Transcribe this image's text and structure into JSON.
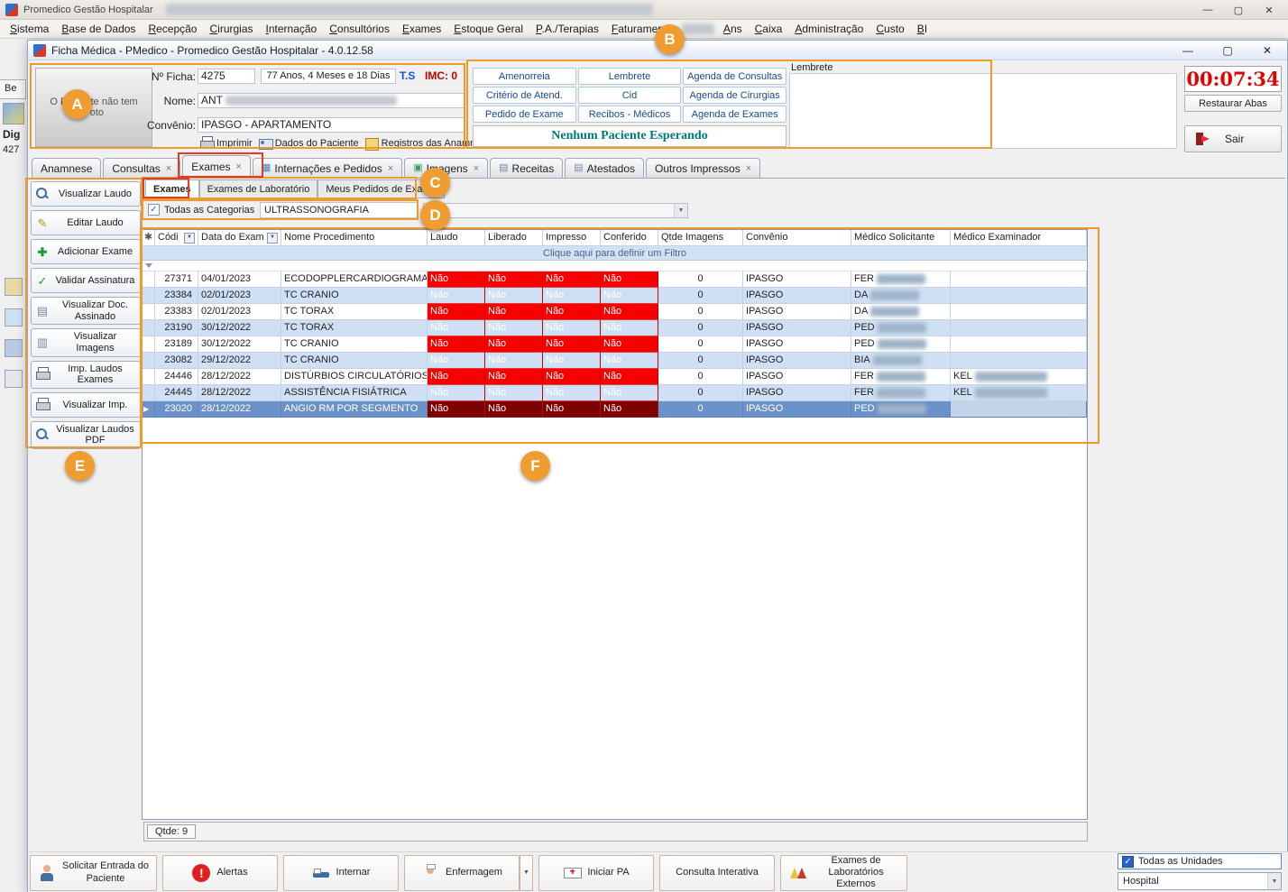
{
  "icons": {
    "minimize": "—",
    "maximize": "▢",
    "close": "✕",
    "close_tab": "×",
    "sort_arrow": "▼",
    "combo_arrow": "▼",
    "check": "✓",
    "pencil": "✎",
    "plus": "✚",
    "doc": "▤",
    "book": "▥",
    "grid": "▦",
    "image": "▣",
    "asterisk": "✱",
    "row_arrow": "▶",
    "alert_mark": "!"
  },
  "main_window": {
    "title": "Promedico Gestão Hospitalar",
    "menu": [
      "Sistema",
      "Base de Dados",
      "Recepção",
      "Cirurgias",
      "Internação",
      "Consultórios",
      "Exames",
      "Estoque Geral",
      "P.A./Terapias",
      "Faturamento",
      "Ans",
      "Caixa",
      "Administração",
      "Custo",
      "BI"
    ],
    "menu_blur_after": "Faturamento"
  },
  "child_window": {
    "title": "Ficha Médica - PMedico - Promedico Gestão Hospitalar - 4.0.12.58"
  },
  "patient": {
    "photo_placeholder": "O Paciente não tem Foto",
    "ficha_label": "Nº Ficha:",
    "ficha_value": "4275",
    "age": "77 Anos, 4 Meses e 18 Dias",
    "ts_label": "T.S",
    "imc_label": "IMC: 0",
    "nome_label": "Nome:",
    "nome_value": "ANT",
    "convenio_label": "Convênio:",
    "convenio_value": "IPASGO - APARTAMENTO",
    "actions": [
      "Imprimir",
      "Dados do Paciente",
      "Registros das Anamneses (Log"
    ]
  },
  "quick_buttons": [
    "Amenorreia",
    "Lembrete",
    "Agenda de Consultas",
    "Critério de Atend.",
    "Cid",
    "Agenda de Cirurgias",
    "Pedido de Exame",
    "Recibos - Médicos",
    "Agenda de Exames"
  ],
  "status_message": "Nenhum Paciente Esperando",
  "lembrete_label": "Lembrete",
  "timer": "00:07:34",
  "restore_tabs_label": "Restaurar Abas",
  "exit_label": "Sair",
  "tabs": [
    {
      "label": "Anamnese",
      "closable": false
    },
    {
      "label": "Consultas",
      "closable": true
    },
    {
      "label": "Exames",
      "closable": true,
      "selected": true
    },
    {
      "label": "Internações e Pedidos",
      "closable": true,
      "icon": "grid"
    },
    {
      "label": "Imagens",
      "closable": true,
      "icon": "image"
    },
    {
      "label": "Receitas",
      "closable": false,
      "icon": "doc"
    },
    {
      "label": "Atestados",
      "closable": false,
      "icon": "doc"
    },
    {
      "label": "Outros Impressos",
      "closable": true
    }
  ],
  "subtabs": [
    "Exames",
    "Exames de Laboratório",
    "Meus Pedidos de Exame"
  ],
  "subtabs_selected": 0,
  "category_filter": {
    "checkbox_label": "Todas as Categorias",
    "checked": true,
    "value": "ULTRASSONOGRAFIA"
  },
  "sidebar_buttons": [
    {
      "label": "Visualizar Laudo",
      "icon": "mag"
    },
    {
      "label": "Editar Laudo",
      "icon": "pencil"
    },
    {
      "label": "Adicionar Exame",
      "icon": "plus"
    },
    {
      "label": "Validar Assinatura",
      "icon": "check"
    },
    {
      "label": "Visualizar Doc. Assinado",
      "icon": "doc"
    },
    {
      "label": "Visualizar Imagens",
      "icon": "book"
    },
    {
      "label": "Imp. Laudos Exames",
      "icon": "print"
    },
    {
      "label": "Visualizar Imp.",
      "icon": "print"
    },
    {
      "label": "Visualizar Laudos PDF",
      "icon": "mag"
    }
  ],
  "grid": {
    "filter_hint": "Clique aqui para definir um Filtro",
    "columns": [
      {
        "label": "Códi",
        "sortable": true
      },
      {
        "label": "Data do Exam",
        "sortable": true
      },
      {
        "label": "Nome Procedimento"
      },
      {
        "label": "Laudo"
      },
      {
        "label": "Liberado"
      },
      {
        "label": "Impresso"
      },
      {
        "label": "Conferido"
      },
      {
        "label": "Qtde Imagens"
      },
      {
        "label": "Convênio"
      },
      {
        "label": "Médico Solicitante"
      },
      {
        "label": "Médico Examinador"
      }
    ],
    "rows": [
      {
        "codigo": "27371",
        "data": "04/01/2023",
        "procedimento": "ECODOPPLERCARDIOGRAMA",
        "laudo": "Não",
        "liberado": "Não",
        "impresso": "Não",
        "conferido": "Não",
        "qtde_imagens": "0",
        "convenio": "IPASGO",
        "solicitante": "FER",
        "examinador": ""
      },
      {
        "codigo": "23384",
        "data": "02/01/2023",
        "procedimento": "TC CRANIO",
        "laudo": "Não",
        "liberado": "Não",
        "impresso": "Não",
        "conferido": "Não",
        "qtde_imagens": "0",
        "convenio": "IPASGO",
        "solicitante": "DA",
        "examinador": ""
      },
      {
        "codigo": "23383",
        "data": "02/01/2023",
        "procedimento": "TC TORAX",
        "laudo": "Não",
        "liberado": "Não",
        "impresso": "Não",
        "conferido": "Não",
        "qtde_imagens": "0",
        "convenio": "IPASGO",
        "solicitante": "DA",
        "examinador": ""
      },
      {
        "codigo": "23190",
        "data": "30/12/2022",
        "procedimento": "TC TORAX",
        "laudo": "Não",
        "liberado": "Não",
        "impresso": "Não",
        "conferido": "Não",
        "qtde_imagens": "0",
        "convenio": "IPASGO",
        "solicitante": "PED",
        "examinador": ""
      },
      {
        "codigo": "23189",
        "data": "30/12/2022",
        "procedimento": "TC CRANIO",
        "laudo": "Não",
        "liberado": "Não",
        "impresso": "Não",
        "conferido": "Não",
        "qtde_imagens": "0",
        "convenio": "IPASGO",
        "solicitante": "PED",
        "examinador": ""
      },
      {
        "codigo": "23082",
        "data": "29/12/2022",
        "procedimento": "TC CRANIO",
        "laudo": "Não",
        "liberado": "Não",
        "impresso": "Não",
        "conferido": "Não",
        "qtde_imagens": "0",
        "convenio": "IPASGO",
        "solicitante": "BIA",
        "examinador": ""
      },
      {
        "codigo": "24446",
        "data": "28/12/2022",
        "procedimento": "DISTÚRBIOS CIRCULATÓRIOS",
        "laudo": "Não",
        "liberado": "Não",
        "impresso": "Não",
        "conferido": "Não",
        "qtde_imagens": "0",
        "convenio": "IPASGO",
        "solicitante": "FER",
        "examinador": "KEL"
      },
      {
        "codigo": "24445",
        "data": "28/12/2022",
        "procedimento": "ASSISTÊNCIA FISIÁTRICA",
        "laudo": "Não",
        "liberado": "Não",
        "impresso": "Não",
        "conferido": "Não",
        "qtde_imagens": "0",
        "convenio": "IPASGO",
        "solicitante": "FER",
        "examinador": "KEL"
      },
      {
        "codigo": "23020",
        "data": "28/12/2022",
        "procedimento": "ANGIO RM POR SEGMENTO",
        "laudo": "Não",
        "liberado": "Não",
        "impresso": "Não",
        "conferido": "Não",
        "qtde_imagens": "0",
        "convenio": "IPASGO",
        "solicitante": "PED",
        "examinador": ""
      }
    ],
    "selected_index": 8,
    "count_label": "Qtde: 9"
  },
  "bottom_toolbar": [
    {
      "label": "Solicitar Entrada do Paciente",
      "icon": "person"
    },
    {
      "label": "Alertas",
      "icon": "alert"
    },
    {
      "label": "Internar",
      "icon": "bed"
    },
    {
      "label": "Enfermagem",
      "icon": "nurse",
      "split": true
    },
    {
      "label": "Iniciar PA",
      "icon": "ambulance"
    },
    {
      "label": "Consulta Interativa"
    },
    {
      "label": "Exames de Laboratórios Externos",
      "icon": "flask"
    }
  ],
  "units_filter": {
    "checkbox_label": "Todas as Unidades",
    "checked": true,
    "value": "Hospital"
  },
  "annotations": {
    "letters": [
      "A",
      "B",
      "C",
      "D",
      "E",
      "F"
    ]
  },
  "background": {
    "tab_fragment": "Be",
    "text_fragment_1": "Dig",
    "text_fragment_2": "427"
  }
}
